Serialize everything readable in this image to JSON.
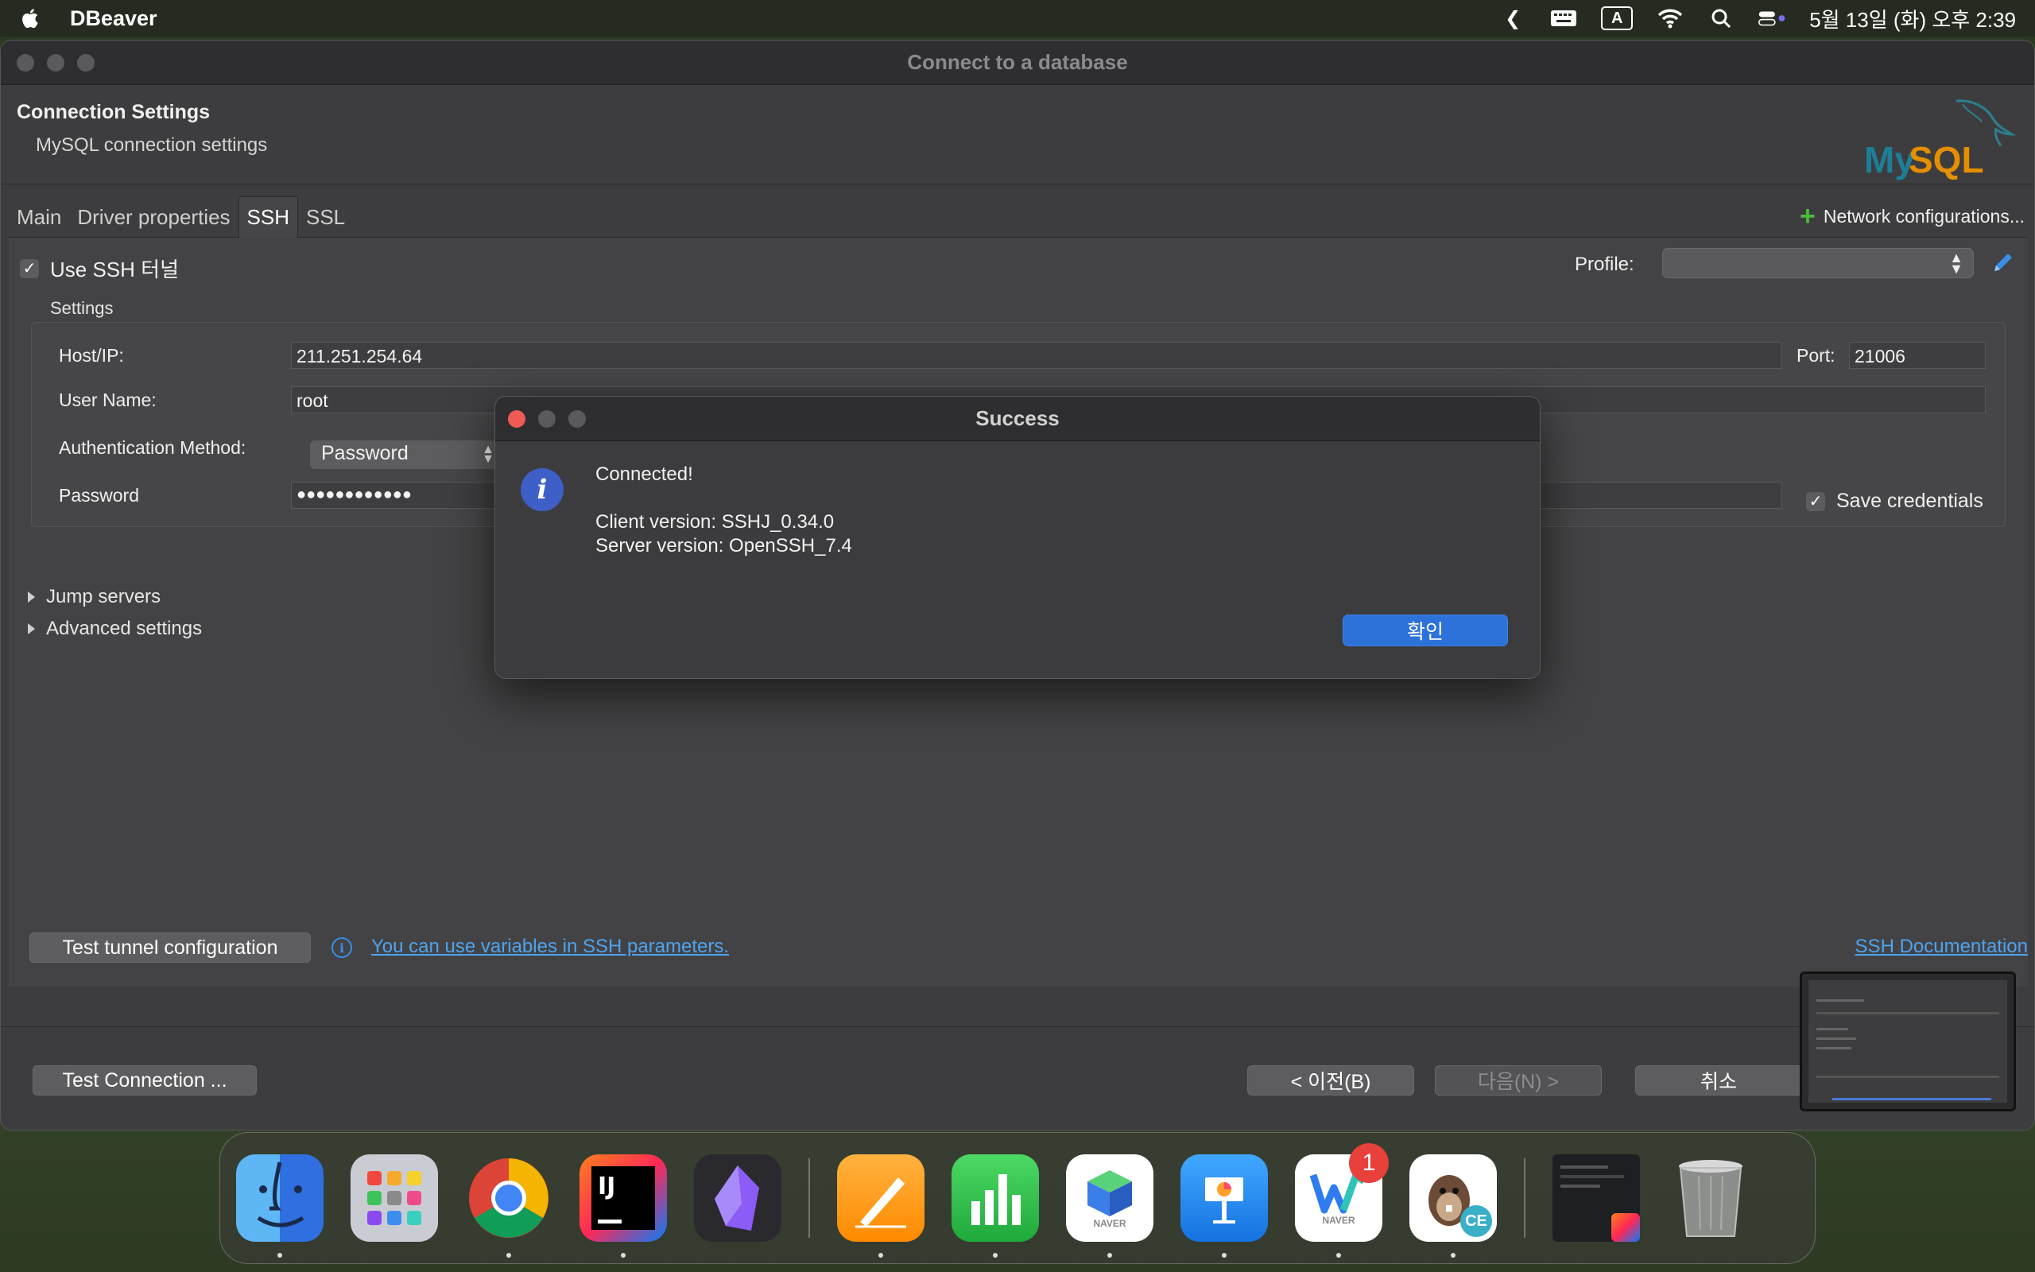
{
  "menubar": {
    "app_name": "DBeaver",
    "input_indicator": "A",
    "clock": "5월 13일 (화) 오후 2:39"
  },
  "window": {
    "title": "Connect to a database",
    "header_title": "Connection Settings",
    "header_subtitle": "MySQL connection settings",
    "logo_text": "MySQL"
  },
  "tabs": [
    "Main",
    "Driver properties",
    "SSH",
    "SSL"
  ],
  "active_tab": "SSH",
  "network_config_label": "Network configurations...",
  "ssh": {
    "use_ssh_label": "Use SSH 터널",
    "use_ssh_checked": true,
    "profile_label": "Profile:",
    "profile_value": "",
    "settings_label": "Settings",
    "host_label": "Host/IP:",
    "host_value": "211.251.254.64",
    "port_label": "Port:",
    "port_value": "21006",
    "user_label": "User Name:",
    "user_value": "root",
    "auth_label": "Authentication Method:",
    "auth_value": "Password",
    "password_label": "Password",
    "password_value": "●●●●●●●●●●●●",
    "save_credentials_label": "Save credentials",
    "save_credentials_checked": true,
    "jump_servers_label": "Jump servers",
    "advanced_label": "Advanced settings",
    "test_tunnel_label": "Test tunnel configuration",
    "variables_link": "You can use variables in SSH parameters.",
    "docs_link": "SSH Documentation"
  },
  "buttons": {
    "test_connection": "Test Connection ...",
    "back": "< 이전(B)",
    "next": "다음(N) >",
    "cancel": "취소"
  },
  "dialog": {
    "title": "Success",
    "line1": "Connected!",
    "line2": "Client version: SSHJ_0.34.0",
    "line3": "Server version: OpenSSH_7.4",
    "ok_label": "확인"
  },
  "dock": {
    "apps": [
      "finder",
      "launchpad",
      "chrome",
      "intellij-idea",
      "obsidian",
      "pages",
      "numbers",
      "naver-whale-box",
      "keynote",
      "naver-whale",
      "dbeaver-ce",
      "intellij-window-preview",
      "trash"
    ],
    "badge_count": "1",
    "naver_text": "NAVER",
    "ce_text": "CE",
    "ij_text": "IJ"
  },
  "colors": {
    "accent_blue": "#2d72d9",
    "link_blue": "#4ea3f0",
    "window_bg": "#3d3d3f",
    "plus_green": "#4cbb3c",
    "close_red": "#ee5b55"
  }
}
